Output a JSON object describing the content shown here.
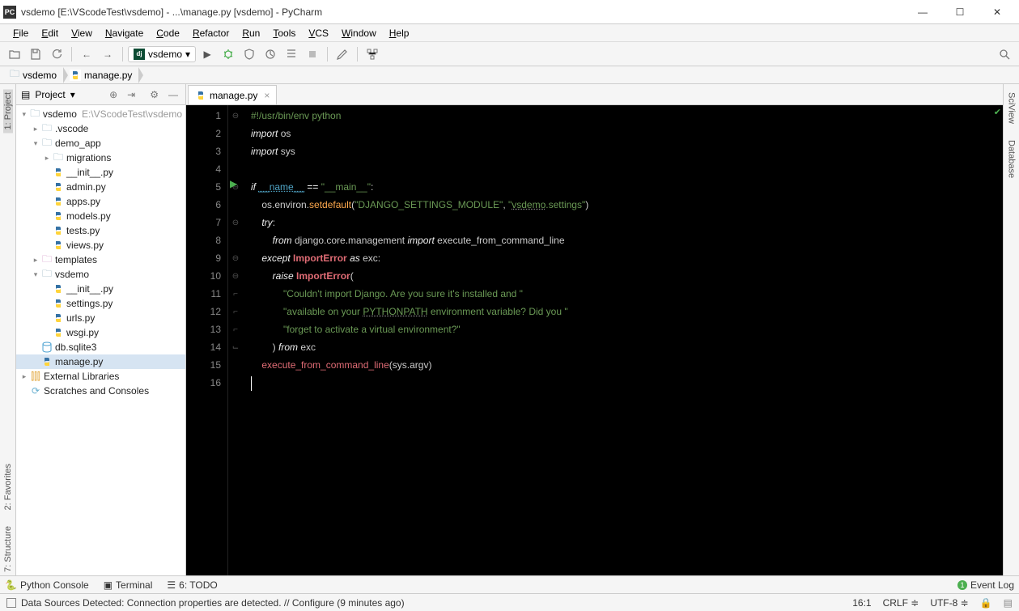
{
  "window": {
    "title": "vsdemo [E:\\VScodeTest\\vsdemo] - ...\\manage.py [vsdemo] - PyCharm",
    "app_icon_text": "PC"
  },
  "menu": [
    "File",
    "Edit",
    "View",
    "Navigate",
    "Code",
    "Refactor",
    "Run",
    "Tools",
    "VCS",
    "Window",
    "Help"
  ],
  "run_config": {
    "label": "vsdemo"
  },
  "breadcrumb": {
    "folder": "vsdemo",
    "file": "manage.py"
  },
  "project_header": {
    "title": "Project"
  },
  "tree": [
    {
      "indent": 0,
      "arrow": "▾",
      "icon": "folder",
      "label": "vsdemo",
      "dim": "E:\\VScodeTest\\vsdemo"
    },
    {
      "indent": 1,
      "arrow": "▸",
      "icon": "folder",
      "label": ".vscode"
    },
    {
      "indent": 1,
      "arrow": "▾",
      "icon": "folder",
      "label": "demo_app"
    },
    {
      "indent": 2,
      "arrow": "▸",
      "icon": "folder",
      "label": "migrations"
    },
    {
      "indent": 2,
      "arrow": "",
      "icon": "py",
      "label": "__init__.py"
    },
    {
      "indent": 2,
      "arrow": "",
      "icon": "py",
      "label": "admin.py"
    },
    {
      "indent": 2,
      "arrow": "",
      "icon": "py",
      "label": "apps.py"
    },
    {
      "indent": 2,
      "arrow": "",
      "icon": "py",
      "label": "models.py"
    },
    {
      "indent": 2,
      "arrow": "",
      "icon": "py",
      "label": "tests.py"
    },
    {
      "indent": 2,
      "arrow": "",
      "icon": "py",
      "label": "views.py"
    },
    {
      "indent": 1,
      "arrow": "▸",
      "icon": "folder-t",
      "label": "templates"
    },
    {
      "indent": 1,
      "arrow": "▾",
      "icon": "folder",
      "label": "vsdemo"
    },
    {
      "indent": 2,
      "arrow": "",
      "icon": "py",
      "label": "__init__.py"
    },
    {
      "indent": 2,
      "arrow": "",
      "icon": "py",
      "label": "settings.py"
    },
    {
      "indent": 2,
      "arrow": "",
      "icon": "py",
      "label": "urls.py"
    },
    {
      "indent": 2,
      "arrow": "",
      "icon": "py",
      "label": "wsgi.py"
    },
    {
      "indent": 1,
      "arrow": "",
      "icon": "db",
      "label": "db.sqlite3"
    },
    {
      "indent": 1,
      "arrow": "",
      "icon": "py",
      "label": "manage.py",
      "selected": true
    },
    {
      "indent": 0,
      "arrow": "▸",
      "icon": "lib",
      "label": "External Libraries"
    },
    {
      "indent": 0,
      "arrow": "",
      "icon": "scratch",
      "label": "Scratches and Consoles"
    }
  ],
  "editor_tab": {
    "label": "manage.py"
  },
  "code_lines": [
    {
      "n": 1,
      "html": "<span class='str'>#!/usr/bin/env python</span>"
    },
    {
      "n": 2,
      "html": "<span class='kw'>import</span> <span class='pl'>os</span>"
    },
    {
      "n": 3,
      "html": "<span class='kw'>import</span> <span class='pl'>sys</span>"
    },
    {
      "n": 4,
      "html": ""
    },
    {
      "n": 5,
      "html": "<span class='kw'>if</span> <span class='dunder'>__name__</span> <span class='op'>==</span> <span class='str'>\"__main__\"</span>:"
    },
    {
      "n": 6,
      "html": "    os.environ.<span class='fn'>setdefault</span>(<span class='str'>\"DJANGO_SETTINGS_MODULE\"</span>, <span class='str'>\"<span class='und'>vsdemo</span>.settings\"</span>)"
    },
    {
      "n": 7,
      "html": "    <span class='kw'>try</span>:"
    },
    {
      "n": 8,
      "html": "        <span class='kw'>from</span> django.core.management <span class='kw'>import</span> execute_from_command_line"
    },
    {
      "n": 9,
      "html": "    <span class='kw'>except</span> <span class='err'>ImportError</span> <span class='kw'>as</span> exc:"
    },
    {
      "n": 10,
      "html": "        <span class='kw'>raise</span> <span class='err'>ImportError</span>("
    },
    {
      "n": 11,
      "html": "            <span class='str'>\"Couldn't import Django. Are you sure it's installed and \"</span>"
    },
    {
      "n": 12,
      "html": "            <span class='str'>\"available on your <span class='und'>PYTHONPATH</span> environment variable? Did you \"</span>"
    },
    {
      "n": 13,
      "html": "            <span class='str'>\"forget to activate a virtual environment?\"</span>"
    },
    {
      "n": 14,
      "html": "        ) <span class='kw'>from</span> exc"
    },
    {
      "n": 15,
      "html": "    <span class='call'>execute_from_command_line</span>(sys.argv)"
    },
    {
      "n": 16,
      "html": "<span class='cursor'></span>"
    }
  ],
  "left_tools": [
    "1: Project",
    "2: Favorites",
    "7: Structure"
  ],
  "right_tools": [
    "SciView",
    "Database"
  ],
  "bottom_tabs": {
    "python_console": "Python Console",
    "terminal": "Terminal",
    "todo": "6: TODO",
    "event_log": "Event Log"
  },
  "status": {
    "message": "Data Sources Detected: Connection properties are detected. // Configure (9 minutes ago)",
    "pos": "16:1",
    "eol": "CRLF",
    "encoding": "UTF-8"
  }
}
